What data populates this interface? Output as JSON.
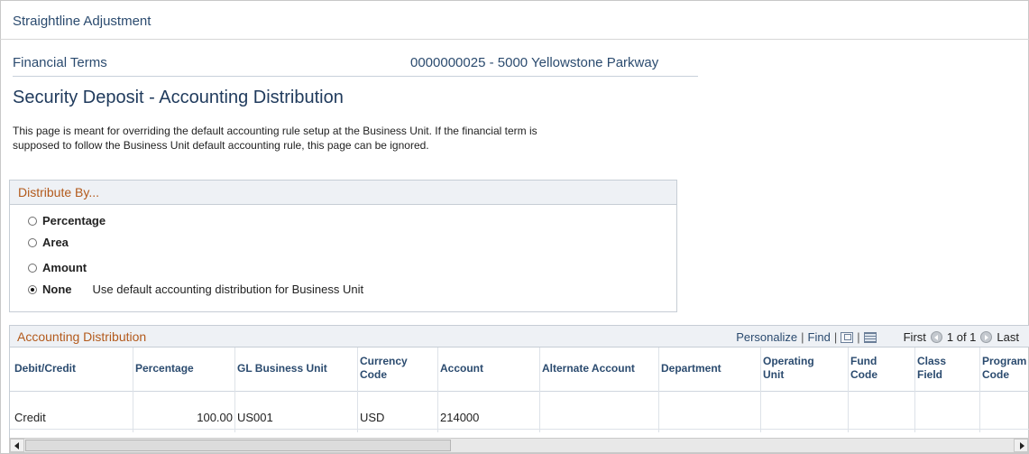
{
  "page_header": "Straightline Adjustment",
  "financial_terms": {
    "label": "Financial Terms",
    "value": "0000000025 - 5000 Yellowstone Parkway"
  },
  "title": "Security Deposit - Accounting Distribution",
  "description": "This page is meant for overriding the default accounting rule setup at the Business Unit. If the financial term is supposed to follow the Business Unit default accounting rule, this page can be ignored.",
  "distribute_by": {
    "heading": "Distribute By...",
    "options": [
      {
        "label": "Percentage",
        "selected": false
      },
      {
        "label": "Area",
        "selected": false
      },
      {
        "label": "Amount",
        "selected": false
      },
      {
        "label": "None",
        "selected": true
      }
    ],
    "none_note": "Use default accounting distribution for Business Unit"
  },
  "grid": {
    "title": "Accounting Distribution",
    "personalize": "Personalize",
    "find": "Find",
    "zoom_icon": "zoom-icon",
    "download_icon": "download-icon",
    "pager": {
      "first": "First",
      "range": "1 of 1",
      "last": "Last"
    },
    "columns": [
      "Debit/Credit",
      "Percentage",
      "GL Business Unit",
      "Currency Code",
      "Account",
      "Alternate Account",
      "Department",
      "Operating Unit",
      "Fund Code",
      "Class Field",
      "Program Code"
    ],
    "rows": [
      {
        "debit_credit": "Credit",
        "percentage": "100.00",
        "gl_business_unit": "US001",
        "currency": "USD",
        "account": "214000"
      }
    ]
  },
  "colors": {
    "heading_blue": "#1f3a5c",
    "section_orange": "#b35a1c",
    "grid_header_bg": "#eef1f5"
  }
}
